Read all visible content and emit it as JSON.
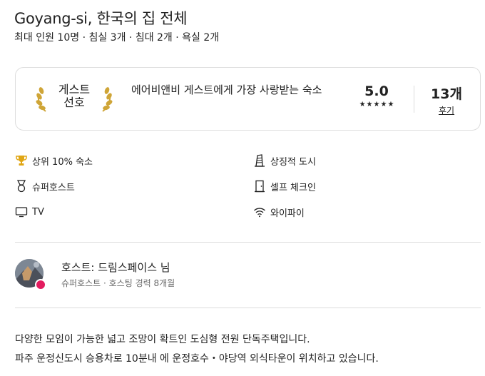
{
  "listing": {
    "title": "Goyang-si, 한국의 집 전체",
    "subtitle": "최대 인원 10명 · 침실 3개 · 침대 2개 · 욕실 2개"
  },
  "guest_favorite": {
    "badge_line1": "게스트",
    "badge_line2": "선호",
    "description": "에어비앤비 게스트에게 가장 사랑받는 숙소",
    "rating": "5.0",
    "stars": [
      "★",
      "★",
      "★",
      "★",
      "★"
    ],
    "review_count": "13개",
    "review_link": "후기",
    "laurel_color": "#cfa537"
  },
  "amenities": [
    {
      "label": "상위 10% 숙소",
      "icon": "trophy-icon"
    },
    {
      "label": "상징적 도시",
      "icon": "landmark-icon"
    },
    {
      "label": "슈퍼호스트",
      "icon": "medal-icon"
    },
    {
      "label": "셀프 체크인",
      "icon": "door-icon"
    },
    {
      "label": "TV",
      "icon": "tv-icon"
    },
    {
      "label": "와이파이",
      "icon": "wifi-icon"
    }
  ],
  "host": {
    "name": "호스트: 드림스페이스 님",
    "meta": "슈퍼호스트 · 호스팅 경력 8개월",
    "badge_color": "#e31c5f"
  },
  "description": {
    "line1": "다양한 모임이 가능한 넓고 조망이 확트인 도심형 전원 단독주택입니다.",
    "line2": "파주 운정신도시 승용차로 10분내 에 운정호수・야당역 외식타운이 위치하고 있습니다."
  }
}
